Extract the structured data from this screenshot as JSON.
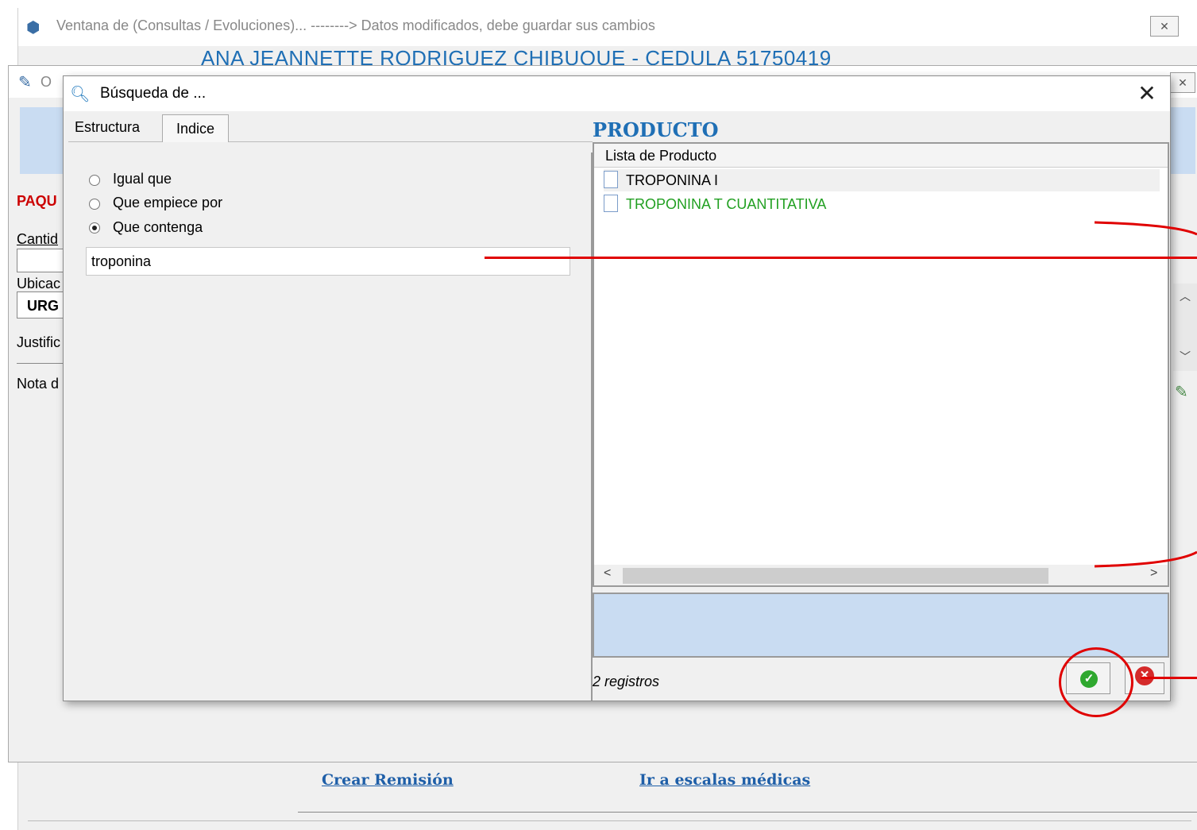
{
  "back_window": {
    "title": "Ventana de (Consultas / Evoluciones)...   -------->  Datos modificados, debe guardar sus cambios",
    "close_label": "✕",
    "patient_name": "ANA JEANNETTE RODRIGUEZ CHIBUQUE  -  CEDULA 51750419",
    "link_remision": "Crear Remisión",
    "link_escalas": "Ir a escalas médicas"
  },
  "middle_window": {
    "title": "O",
    "close_label": "✕",
    "paquete_label": "PAQU",
    "cantidad_label": "Cantid",
    "ubicacion_label": "Ubicac",
    "ubicacion_value": "URG",
    "justificacion_label": "Justific",
    "nota_label": "Nota d"
  },
  "dialog": {
    "title": "Búsqueda de ...",
    "close_label": "✕",
    "tabs": [
      {
        "label": "Estructura",
        "active": false
      },
      {
        "label": "Indice",
        "active": true
      }
    ],
    "search_options": [
      {
        "label": "Igual que",
        "selected": false
      },
      {
        "label": "Que empiece por",
        "selected": false
      },
      {
        "label": "Que contenga",
        "selected": true
      }
    ],
    "search_value": "troponina",
    "product_title": "PRODUCTO",
    "list_header": "Lista de Producto",
    "items": [
      {
        "label": "TROPONINA I",
        "color": "#000000"
      },
      {
        "label": "TROPONINA T CUANTITATIVA",
        "color": "#22a022"
      }
    ],
    "record_count": "2 registros",
    "ok_icon": "check-icon",
    "cancel_icon": "cancel-icon"
  },
  "colors": {
    "accent_blue": "#1f6fb5",
    "annotation_red": "#e00000",
    "header_blue": "#c9dcf2"
  }
}
